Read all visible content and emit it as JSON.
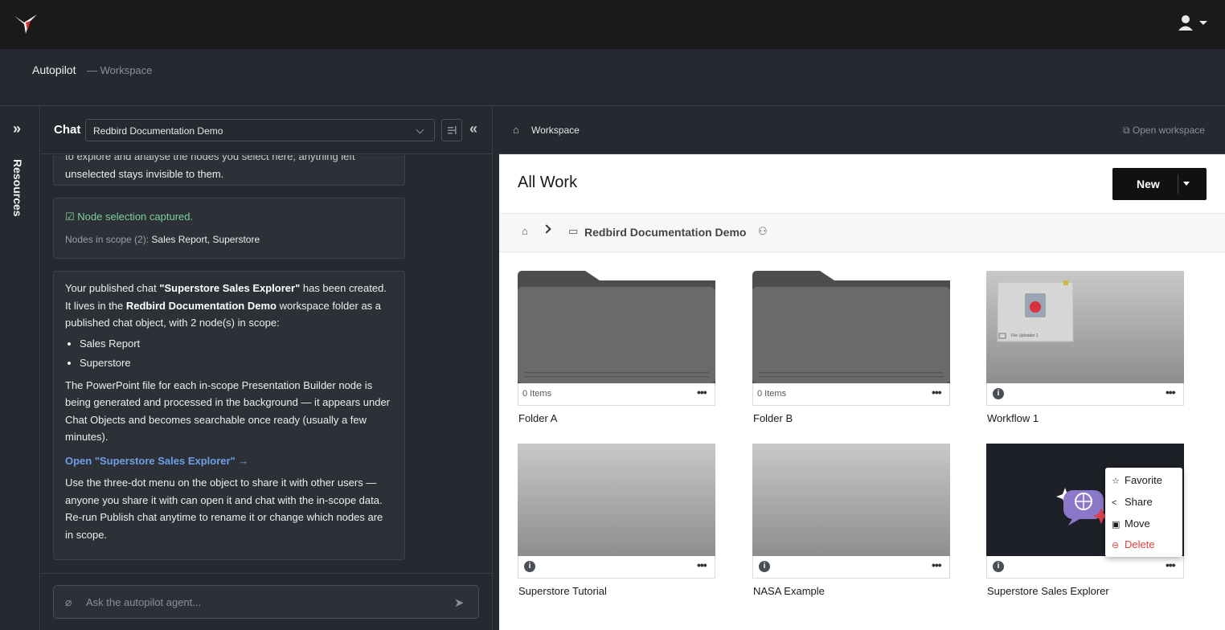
{
  "header": {
    "app": "Autopilot",
    "section": "— Workspace"
  },
  "rail": {
    "label": "Resources"
  },
  "chat": {
    "title": "Chat",
    "workspace_select": "Redbird Documentation Demo",
    "cut_text_1": "to explore and analyse the nodes you select here; anything left",
    "cut_text_2": "unselected stays invisible to them.",
    "captured": "Node selection captured.",
    "scope_label": "Nodes in scope (2):",
    "scope_value": "Sales Report, Superstore",
    "msg_a": "Your published chat ",
    "msg_name": "\"Superstore Sales Explorer\"",
    "msg_b": " has been created. It lives in the ",
    "msg_ws": "Redbird Documentation Demo",
    "msg_c": " workspace folder as a published chat object, with 2 node(s) in scope:",
    "nodes": [
      "Sales Report",
      "Superstore"
    ],
    "msg_d": "The PowerPoint file for each in-scope Presentation Builder node is being generated and processed in the background — it appears under Chat Objects and becomes searchable once ready (usually a few minutes).",
    "open_link": "Open \"Superstore Sales Explorer\" →",
    "msg_e": "Use the three-dot menu on the object to share it with other users — anyone you share it with can open it and chat with the in-scope data. Re-run Publish chat anytime to rename it or change which nodes are in scope.",
    "input_placeholder": "Ask the autopilot agent..."
  },
  "workspace": {
    "header_label": "Workspace",
    "open_workspace": "Open workspace",
    "title": "All Work",
    "new_button": "New",
    "breadcrumb_folder": "Redbird Documentation Demo",
    "tiles": [
      {
        "name": "Folder A",
        "meta": "0 Items"
      },
      {
        "name": "Folder B",
        "meta": "0 Items"
      },
      {
        "name": "Workflow 1",
        "meta": "",
        "thumb_label": "File Uploader 1"
      },
      {
        "name": "Superstore Tutorial",
        "meta": ""
      },
      {
        "name": "NASA Example",
        "meta": ""
      },
      {
        "name": "Superstore Sales Explorer",
        "meta": ""
      }
    ],
    "context_menu": [
      "Favorite",
      "Share",
      "Move",
      "Delete"
    ]
  },
  "colors": {
    "accent_link": "#6f9ee6",
    "success": "#7fcf9a",
    "danger": "#e0413a",
    "brand_red": "#d9313a"
  }
}
